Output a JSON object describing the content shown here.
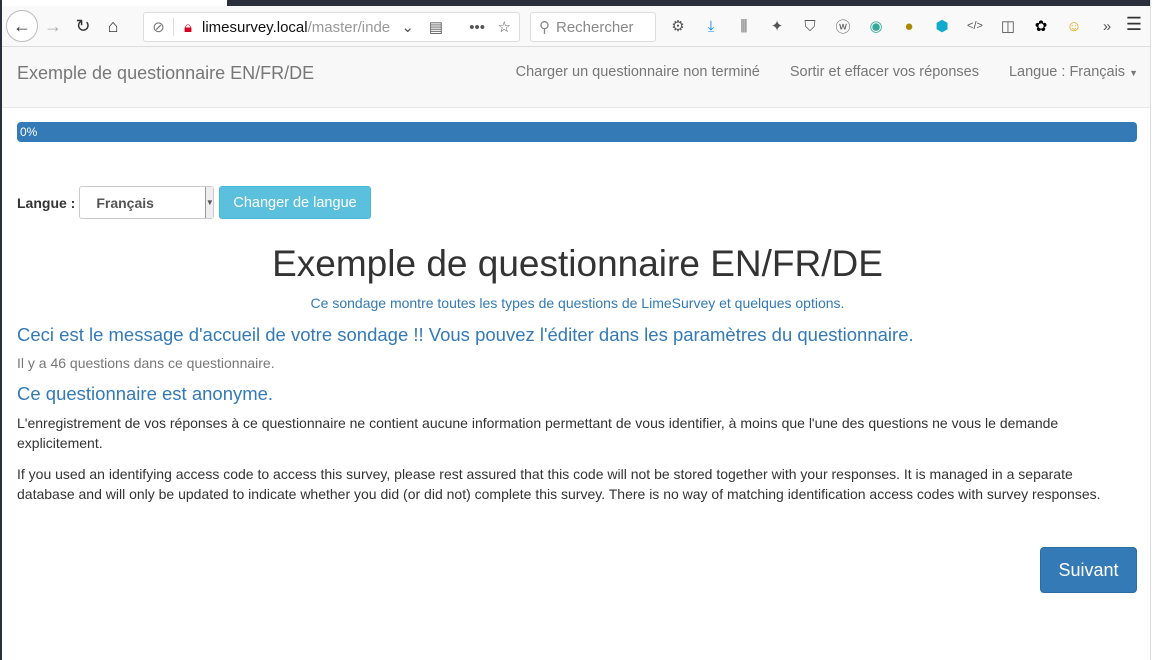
{
  "browser": {
    "url_host": "limesurvey.local",
    "url_path": "/master/inde",
    "search_placeholder": "Rechercher",
    "icons": [
      "gear-icon",
      "download-icon",
      "library-icon",
      "extension-icon",
      "ublock-icon",
      "wappalyzer-icon",
      "sync-icon",
      "globe-warning-icon",
      "cube-icon",
      "code-icon",
      "sidebar-icon",
      "paw-icon",
      "smiley-icon",
      "overflow-icon"
    ]
  },
  "navbar": {
    "brand": "Exemple de questionnaire EN/FR/DE",
    "links": [
      "Charger un questionnaire non terminé",
      "Sortir et effacer vos réponses",
      "Langue : Français"
    ]
  },
  "progress": {
    "value": 0,
    "label": "0%"
  },
  "language": {
    "label": "Langue :",
    "selected": "Français",
    "button": "Changer de langue"
  },
  "main": {
    "title": "Exemple de questionnaire EN/FR/DE",
    "subtitle": "Ce sondage montre toutes les types de questions de LimeSurvey et quelques options.",
    "welcome": "Ceci est le message d'accueil de votre sondage !! Vous pouvez l'éditer dans les paramètres du questionnaire.",
    "question_count": "Il y a 46 questions dans ce questionnaire.",
    "anonymous_heading": "Ce questionnaire est anonyme.",
    "anonymous_text": "L'enregistrement de vos réponses à ce questionnaire ne contient aucune information permettant de vous identifier, à moins que l'une des questions ne vous le demande explicitement.",
    "access_code_text": "If you used an identifying access code to access this survey, please rest assured that this code will not be stored together with your responses. It is managed in a separate database and will only be updated to indicate whether you did (or did not) complete this survey. There is no way of matching identification access codes with survey responses.",
    "next_button": "Suivant"
  }
}
